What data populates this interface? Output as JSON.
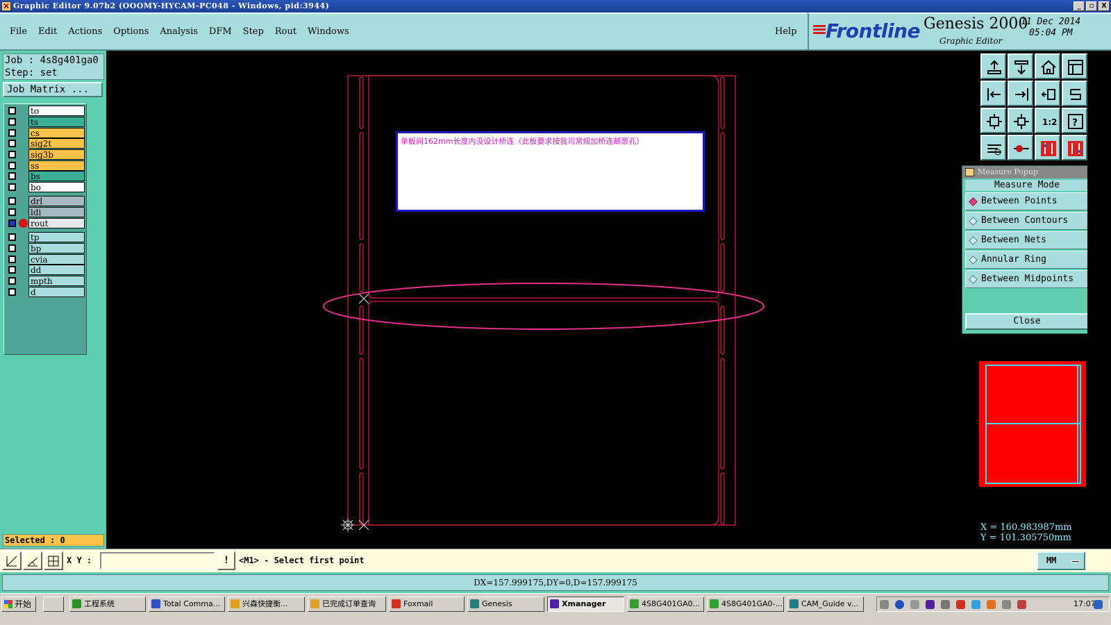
{
  "window": {
    "title": "Graphic Editor 9.07b2 (OOOMY-HYCAM-PC048 - Windows, pid:3944)",
    "controls": [
      "_",
      "▫",
      "X"
    ]
  },
  "menu": {
    "items": [
      "File",
      "Edit",
      "Actions",
      "Options",
      "Analysis",
      "DFM",
      "Step",
      "Rout",
      "Windows"
    ],
    "help": "Help"
  },
  "brand": {
    "logo": "Frontline",
    "product": "Genesis 2000",
    "subtitle": "Graphic Editor",
    "date": "11 Dec 2014",
    "time": "05:04 PM"
  },
  "job": {
    "job_line": "Job : 4s8g401ga0",
    "step_line": "Step: set",
    "matrix_button": "Job Matrix ..."
  },
  "layers": [
    {
      "name": "to",
      "color": "#ffffff",
      "active": false
    },
    {
      "name": "ts",
      "color": "#3bb097",
      "active": false
    },
    {
      "name": "cs",
      "color": "#fdc24a",
      "active": false
    },
    {
      "name": "sig2t",
      "color": "#fdc24a",
      "active": false
    },
    {
      "name": "sig3b",
      "color": "#fdc24a",
      "active": false
    },
    {
      "name": "ss",
      "color": "#fdc24a",
      "active": false
    },
    {
      "name": "bs",
      "color": "#3bb097",
      "active": false
    },
    {
      "name": "bo",
      "color": "#ffffff",
      "active": false
    },
    {
      "name": "drl",
      "color": "#a8b8c0",
      "active": false
    },
    {
      "name": "ldi",
      "color": "#a8b8c0",
      "active": false
    },
    {
      "name": "rout",
      "color": "#e8e8e8",
      "active": true
    },
    {
      "name": "tp",
      "color": "#a9dcdc",
      "active": false
    },
    {
      "name": "bp",
      "color": "#a9dcdc",
      "active": false
    },
    {
      "name": "cvia",
      "color": "#a9dcdc",
      "active": false
    },
    {
      "name": "dd",
      "color": "#a9dcdc",
      "active": false
    },
    {
      "name": "mpth",
      "color": "#a9dcdc",
      "active": false
    },
    {
      "name": "d",
      "color": "#a9dcdc",
      "active": false
    }
  ],
  "selected": "Selected : 0",
  "canvas": {
    "note_text": "单板间162mm长度内没设计桥连（此板要求按我司常规加桥连邮票孔）",
    "outline_color": "#d8203a",
    "ellipse_color": "#e0308a",
    "note_text_color": "#d21fc4"
  },
  "toolbar_icons": [
    "pan-up-icon",
    "pan-down-icon",
    "home-icon",
    "window-icon",
    "pan-left-icon",
    "pan-right-icon",
    "zoom-back-icon",
    "redraw-icon",
    "zoom-fit-icon",
    "zoom-center-icon",
    "zoom-1to2-icon",
    "help-icon",
    "measure-icon",
    "pad-icon",
    "layer-a-icon",
    "layer-b-icon"
  ],
  "measure_popup": {
    "title": "Measure Popup",
    "heading": "Measure Mode",
    "options": [
      {
        "label": "Between Points",
        "selected": true
      },
      {
        "label": "Between Contours",
        "selected": false
      },
      {
        "label": "Between Nets",
        "selected": false
      },
      {
        "label": "Annular Ring",
        "selected": false
      },
      {
        "label": "Between Midpoints",
        "selected": false
      }
    ],
    "close": "Close"
  },
  "coords": {
    "x": "X = 160.983987mm",
    "y": "Y = 101.305750mm"
  },
  "command": {
    "xy_label": "X Y :",
    "xy_value": "",
    "warn": "!",
    "prompt": "<M1> - Select first point",
    "units": "MM"
  },
  "status": "DX=157.999175,DY=0,D=157.999175",
  "taskbar": {
    "start": "开始",
    "tasks": [
      {
        "label": "工程系统",
        "icon_color": "#2a8f2a",
        "active": false
      },
      {
        "label": "Total Comma...",
        "icon_color": "#3050c0",
        "active": false
      },
      {
        "label": "兴森快捷衡...",
        "icon_color": "#e0a020",
        "active": false
      },
      {
        "label": "已完成订单查询",
        "icon_color": "#e0a020",
        "active": false
      },
      {
        "label": "Foxmail",
        "icon_color": "#d03020",
        "active": false
      },
      {
        "label": "Genesis",
        "icon_color": "#208080",
        "active": false
      },
      {
        "label": "Xmanager",
        "icon_color": "#5020a0",
        "active": true
      },
      {
        "label": "4S8G401GA0...",
        "icon_color": "#30a030",
        "active": false
      },
      {
        "label": "4S8G401GA0-...",
        "icon_color": "#30a030",
        "active": false
      },
      {
        "label": "CAM_Guide v...",
        "icon_color": "#208080",
        "active": false
      }
    ],
    "clock": "17:07"
  }
}
